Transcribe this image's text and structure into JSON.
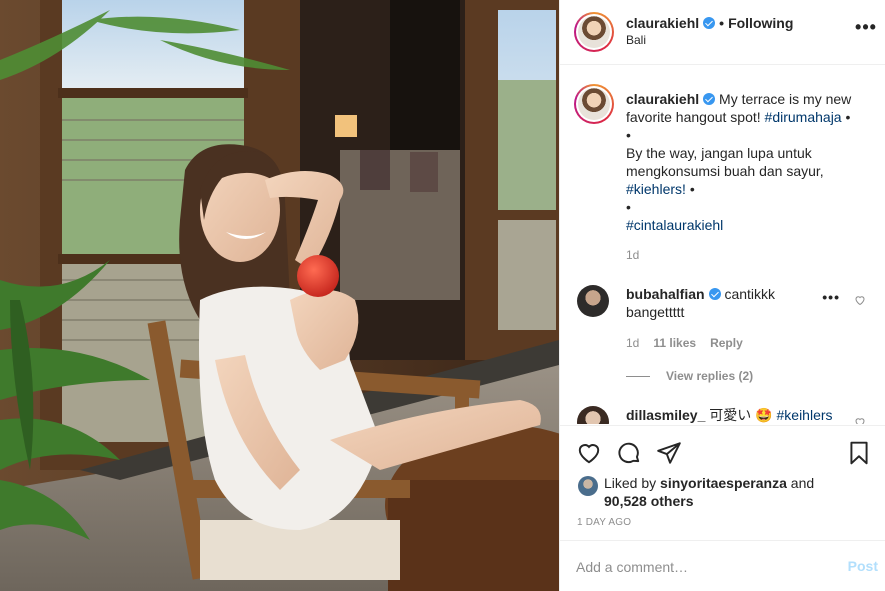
{
  "post": {
    "username": "claurakiehl",
    "follow_status": "Following",
    "location": "Bali"
  },
  "caption": {
    "username": "claurakiehl",
    "line1": "My terrace is my new",
    "line2_text": "favorite hangout spot! ",
    "line2_tag": "#dirumahaja",
    "bullet": "•",
    "line4": "By the way, jangan lupa untuk",
    "line5": "mengkonsumsi buah dan sayur,",
    "line6_tag": "#kiehlers!",
    "line8_tag": "#cintalaurakiehl",
    "time": "1d"
  },
  "comments": [
    {
      "username": "bubahalfian",
      "text_line1": "cantikkk",
      "text_line2": "bangettttt",
      "time": "1d",
      "likes": "11 likes",
      "reply": "Reply",
      "view_replies": "View replies (2)"
    },
    {
      "username": "dillasmiley_",
      "text": "可愛い",
      "emoji": "🤩",
      "tag": "#keihlers"
    }
  ],
  "likes": {
    "prefix": "Liked by",
    "user": "sinyoritaesperanza",
    "and": "and",
    "count": "90,528 others"
  },
  "timestamp": "1 DAY AGO",
  "add_comment": {
    "placeholder": "Add a comment…",
    "post_label": "Post"
  },
  "icons": {
    "more": "more-options-icon",
    "like": "heart-icon",
    "comment": "comment-icon",
    "share": "share-icon",
    "save": "bookmark-icon",
    "verified": "verified-badge-icon"
  },
  "colors": {
    "accent_blue": "#3897f0",
    "hashtag": "#00376b",
    "muted": "#8e8e8e",
    "post_disabled": "#b2dffc"
  }
}
